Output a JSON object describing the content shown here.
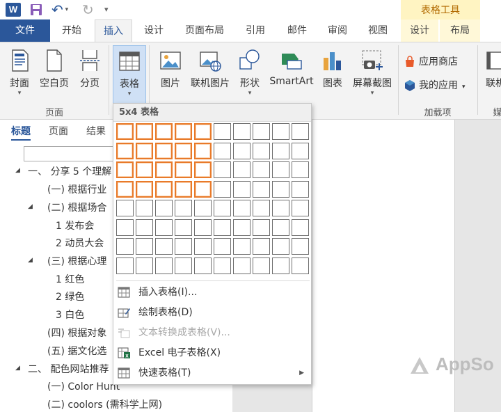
{
  "app": {
    "word_icon_letter": "W"
  },
  "context_tab_header": "表格工具",
  "tabs": [
    "文件",
    "开始",
    "插入",
    "设计",
    "页面布局",
    "引用",
    "邮件",
    "审阅",
    "视图",
    "设计",
    "布局"
  ],
  "ribbon": {
    "cover_label": "封面",
    "blank_label": "空白页",
    "break_label": "分页",
    "table_label": "表格",
    "picture_label": "图片",
    "online_picture_label": "联机图片",
    "shape_label": "形状",
    "smartart_label": "SmartArt",
    "chart_label": "图表",
    "screenshot_label": "屏幕截图",
    "store_label": "应用商店",
    "myapps_label": "我的应用",
    "online_video_label": "联机",
    "group_pages": "页面",
    "group_addins": "加载项",
    "group_media": "媒"
  },
  "nav": {
    "tabs": [
      "标题",
      "页面",
      "结果"
    ],
    "tree": [
      "一、 分享 5 个理解",
      "(一)  根据行业",
      "(二)  根据场合",
      "1 发布会",
      "2 动员大会",
      "(三)  根据心理",
      "1 红色",
      "2 绿色",
      "3 白色",
      "(四)  根据对象",
      "(五)  据文化选",
      "二、 配色网站推荐",
      "(一)  Color Hunt",
      "(二)  coolors  (需科学上网)"
    ]
  },
  "table_dropdown": {
    "header": "5x4 表格",
    "grid_cols": 10,
    "grid_rows": 8,
    "selected_cols": 5,
    "selected_rows": 4,
    "items": [
      {
        "label": "插入表格(I)...",
        "enabled": true
      },
      {
        "label": "绘制表格(D)",
        "enabled": true
      },
      {
        "label": "文本转换成表格(V)...",
        "enabled": false
      },
      {
        "label": "Excel 电子表格(X)",
        "enabled": true
      },
      {
        "label": "快速表格(T)",
        "enabled": true
      }
    ]
  },
  "watermark": "AppSo",
  "colors": {
    "brand_blue": "#2b579a",
    "highlight_orange": "#e87a2a",
    "context_yellow": "#fff4c2"
  }
}
